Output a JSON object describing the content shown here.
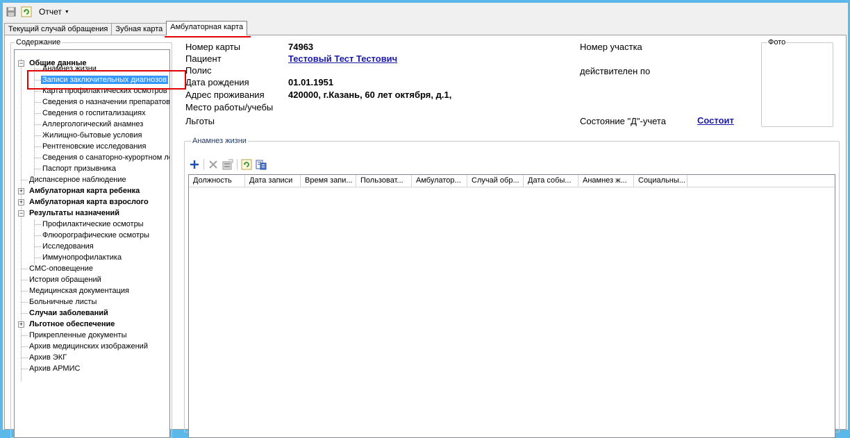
{
  "toolbar": {
    "save_icon": "save-icon",
    "refresh_icon": "refresh-icon",
    "report_label": "Отчет"
  },
  "tabs": [
    {
      "label": "Текущий случай обращения"
    },
    {
      "label": "Зубная карта"
    },
    {
      "label": "Амбулаторная карта"
    }
  ],
  "sidebar": {
    "title": "Содержание",
    "items": [
      {
        "label": "Общие данные"
      },
      {
        "label": "Анамнез жизни"
      },
      {
        "label": "Записи заключительных диагнозов"
      },
      {
        "label": "Карта профилактических осмотров"
      },
      {
        "label": "Сведения о назначении препаратов,"
      },
      {
        "label": "Сведения о госпитализациях"
      },
      {
        "label": "Аллергологический анамнез"
      },
      {
        "label": "Жилищно-бытовые условия"
      },
      {
        "label": "Рентгеновские исследования"
      },
      {
        "label": "Сведения о санаторно-курортном леч"
      },
      {
        "label": "Паспорт призывника"
      },
      {
        "label": "Диспансерное наблюдение"
      },
      {
        "label": "Амбулаторная карта ребенка"
      },
      {
        "label": "Амбулаторная карта взрослого"
      },
      {
        "label": "Результаты назначений"
      },
      {
        "label": "Профилактические осмотры"
      },
      {
        "label": "Флюорографические осмотры"
      },
      {
        "label": "Исследования"
      },
      {
        "label": "Иммунопрофилактика"
      },
      {
        "label": "СМС-оповещение"
      },
      {
        "label": "История обращений"
      },
      {
        "label": "Медицинская документация"
      },
      {
        "label": "Больничные листы"
      },
      {
        "label": "Случаи заболеваний"
      },
      {
        "label": "Льготное обеспечение"
      },
      {
        "label": "Прикрепленные документы"
      },
      {
        "label": "Архив медицинских изображений"
      },
      {
        "label": "Архив ЭКГ"
      },
      {
        "label": "Архив АРМИС"
      }
    ]
  },
  "patient": {
    "card_number_label": "Номер карты",
    "card_number": "74963",
    "patient_label": "Пациент",
    "patient_name": "Тестовый Тест Тестович",
    "policy_label": "Полис",
    "birth_date_label": "Дата рождения",
    "birth_date": "01.01.1951",
    "address_label": "Адрес проживания",
    "address": "420000, г.Казань, 60 лет октября, д.1,",
    "work_label": "Место работы/учебы",
    "benefits_label": "Льготы",
    "district_label": "Номер участка",
    "valid_until_label": "действителен по",
    "d_status_label": "Состояние \"Д\"-учета",
    "d_status_value": "Состоит",
    "photo_label": "Фото"
  },
  "anamnesis": {
    "title": "Анамнез жизни",
    "columns": [
      "Должность",
      "Дата записи",
      "Время запи...",
      "Пользоват...",
      "Амбулатор...",
      "Случай обр...",
      "Дата собы...",
      "Анамнез ж...",
      "Социальны..."
    ]
  },
  "colors": {
    "selection": "#3399ff",
    "highlight": "#e00000",
    "link": "#1a1aa6",
    "window_bg": "#5bb8e8"
  }
}
